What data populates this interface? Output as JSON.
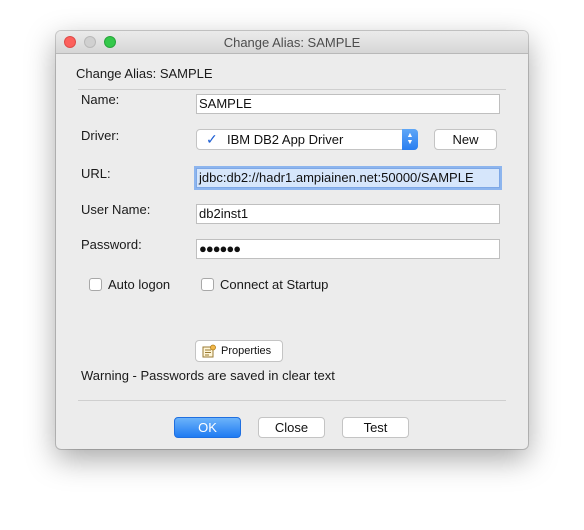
{
  "window": {
    "title": "Change Alias: SAMPLE"
  },
  "dialog": {
    "heading": "Change Alias: SAMPLE",
    "fields": {
      "name": {
        "label": "Name:",
        "value": "SAMPLE"
      },
      "driver": {
        "label": "Driver:",
        "selected": "IBM DB2 App Driver",
        "new_button": "New"
      },
      "url": {
        "label": "URL:",
        "value": "jdbc:db2://hadr1.ampiainen.net:50000/SAMPLE"
      },
      "user_name": {
        "label": "User Name:",
        "value": "db2inst1"
      },
      "password": {
        "label": "Password:",
        "value": "●●●●●●"
      }
    },
    "checkboxes": {
      "auto_logon": {
        "label": "Auto logon",
        "checked": false
      },
      "connect_at_startup": {
        "label": "Connect at Startup",
        "checked": false
      }
    },
    "properties_button": "Properties",
    "warning": "Warning - Passwords are saved in clear text"
  },
  "footer": {
    "ok": "OK",
    "close": "Close",
    "test": "Test"
  },
  "colors": {
    "accent": "#1f7bf2",
    "focus": "#8db5ee",
    "window_bg": "#ececec"
  }
}
